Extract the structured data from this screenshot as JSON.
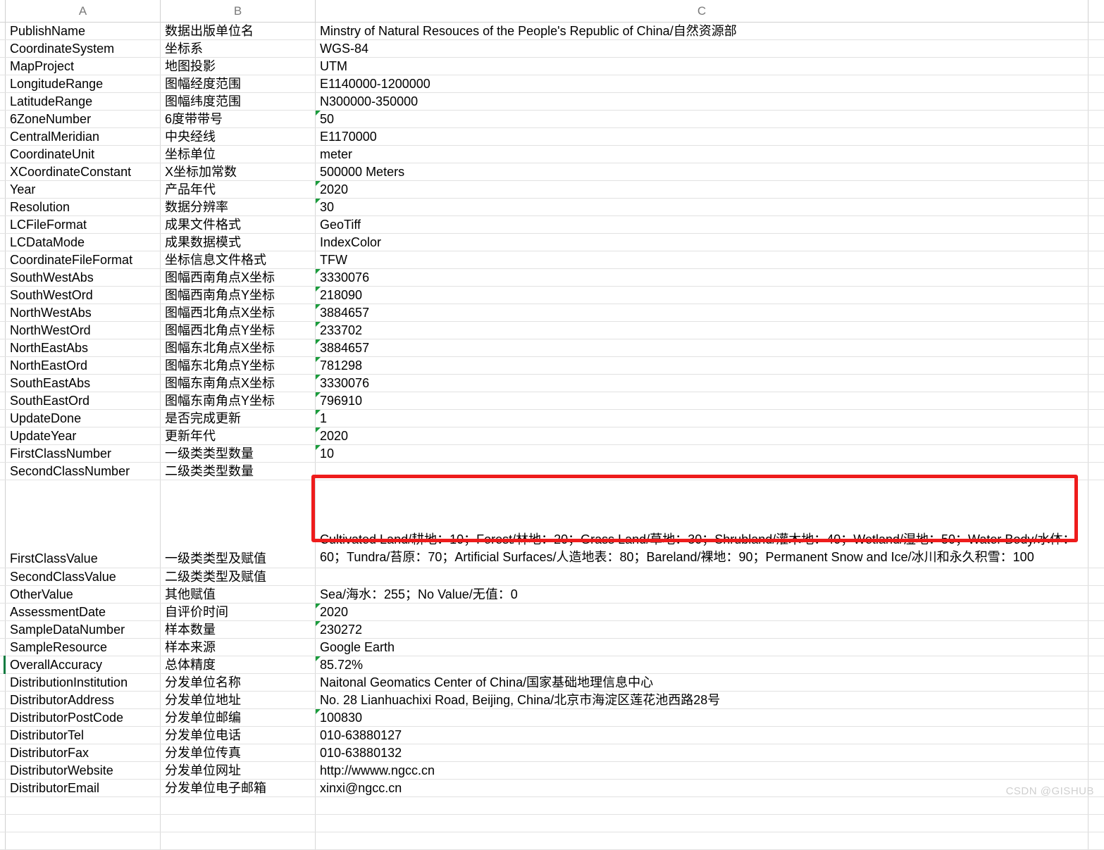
{
  "app": {
    "type": "spreadsheet",
    "watermark": "CSDN @GISHUB"
  },
  "columns": {
    "a": "A",
    "b": "B",
    "c": "C"
  },
  "colors": {
    "error_flag_green": "#1a9c3c",
    "selection_green": "#107c41",
    "annotation_red": "#ee1c1c",
    "grid_line": "#d8d8d8",
    "header_text": "#7a7a7a",
    "watermark": "#cfcfcf"
  },
  "rows": [
    {
      "a": "PublishName",
      "b": "数据出版单位名",
      "c": "Minstry of Natural Resouces of the People's Republic of China/自然资源部",
      "flag": false
    },
    {
      "a": "CoordinateSystem",
      "b": "坐标系",
      "c": "WGS-84",
      "flag": false
    },
    {
      "a": "MapProject",
      "b": "地图投影",
      "c": "UTM",
      "flag": false
    },
    {
      "a": "LongitudeRange",
      "b": "图幅经度范围",
      "c": "E1140000-1200000",
      "flag": false
    },
    {
      "a": "LatitudeRange",
      "b": "图幅纬度范围",
      "c": "N300000-350000",
      "flag": false
    },
    {
      "a": "6ZoneNumber",
      "b": "6度带带号",
      "c": "50",
      "flag": true
    },
    {
      "a": "CentralMeridian",
      "b": "中央经线",
      "c": "E1170000",
      "flag": false
    },
    {
      "a": "CoordinateUnit",
      "b": "坐标单位",
      "c": "meter",
      "flag": false
    },
    {
      "a": "XCoordinateConstant",
      "b": "X坐标加常数",
      "c": "500000 Meters",
      "flag": false
    },
    {
      "a": "Year",
      "b": "产品年代",
      "c": "2020",
      "flag": true
    },
    {
      "a": "Resolution",
      "b": "数据分辨率",
      "c": "30",
      "flag": true
    },
    {
      "a": "LCFileFormat",
      "b": "成果文件格式",
      "c": "GeoTiff",
      "flag": false
    },
    {
      "a": "LCDataMode",
      "b": "成果数据模式",
      "c": "IndexColor",
      "flag": false
    },
    {
      "a": "CoordinateFileFormat",
      "b": "坐标信息文件格式",
      "c": "TFW",
      "flag": false
    },
    {
      "a": "SouthWestAbs",
      "b": "图幅西南角点X坐标",
      "c": "3330076",
      "flag": true
    },
    {
      "a": "SouthWestOrd",
      "b": "图幅西南角点Y坐标",
      "c": "218090",
      "flag": true
    },
    {
      "a": "NorthWestAbs",
      "b": "图幅西北角点X坐标",
      "c": "3884657",
      "flag": true
    },
    {
      "a": "NorthWestOrd",
      "b": "图幅西北角点Y坐标",
      "c": "233702",
      "flag": true
    },
    {
      "a": "NorthEastAbs",
      "b": "图幅东北角点X坐标",
      "c": "3884657",
      "flag": true
    },
    {
      "a": "NorthEastOrd",
      "b": "图幅东北角点Y坐标",
      "c": "781298",
      "flag": true
    },
    {
      "a": "SouthEastAbs",
      "b": "图幅东南角点X坐标",
      "c": "3330076",
      "flag": true
    },
    {
      "a": "SouthEastOrd",
      "b": "图幅东南角点Y坐标",
      "c": "796910",
      "flag": true
    },
    {
      "a": "UpdateDone",
      "b": "是否完成更新",
      "c": "1",
      "flag": true
    },
    {
      "a": "UpdateYear",
      "b": "更新年代",
      "c": "2020",
      "flag": true
    },
    {
      "a": "FirstClassNumber",
      "b": "一级类类型数量",
      "c": "10",
      "flag": true
    },
    {
      "a": "SecondClassNumber",
      "b": "二级类类型数量",
      "c": "",
      "flag": false
    },
    {
      "a": "FirstClassValue",
      "b": "一级类类型及赋值",
      "c": "Cultivated Land/耕地：10；Forest/林地：20；Grass Land/草地：30；Shrubland/灌木地：40；Wetland/湿地：50；Water Body/水体：60；Tundra/苔原：70；Artificial Surfaces/人造地表：80；Bareland/裸地：90；Permanent Snow and Ice/冰川和永久积雪：100",
      "flag": false,
      "tall": true,
      "highlighted": true
    },
    {
      "a": "SecondClassValue",
      "b": "二级类类型及赋值",
      "c": "",
      "flag": false
    },
    {
      "a": "OtherValue",
      "b": "其他赋值",
      "c": "Sea/海水：255；No Value/无值：0",
      "flag": false
    },
    {
      "a": "AssessmentDate",
      "b": "自评价时间",
      "c": "2020",
      "flag": true
    },
    {
      "a": "SampleDataNumber",
      "b": "样本数量",
      "c": "230272",
      "flag": true
    },
    {
      "a": "SampleResource",
      "b": "样本来源",
      "c": "Google Earth",
      "flag": false
    },
    {
      "a": "OverallAccuracy",
      "b": "总体精度",
      "c": "85.72%",
      "flag": true,
      "selected": true
    },
    {
      "a": "DistributionInstitution",
      "b": "分发单位名称",
      "c": "Naitonal Geomatics Center of China/国家基础地理信息中心",
      "flag": false
    },
    {
      "a": "DistributorAddress",
      "b": "分发单位地址",
      "c": "No. 28 Lianhuachixi Road, Beijing, China/北京市海淀区莲花池西路28号",
      "flag": false
    },
    {
      "a": "DistributorPostCode",
      "b": "分发单位邮编",
      "c": "100830",
      "flag": true
    },
    {
      "a": "DistributorTel",
      "b": "分发单位电话",
      "c": "010-63880127",
      "flag": false
    },
    {
      "a": "DistributorFax",
      "b": "分发单位传真",
      "c": "010-63880132",
      "flag": false
    },
    {
      "a": "DistributorWebsite",
      "b": "分发单位网址",
      "c": "http://wwww.ngcc.cn",
      "flag": false
    },
    {
      "a": "DistributorEmail",
      "b": "分发单位电子邮箱",
      "c": "xinxi@ngcc.cn",
      "flag": false
    },
    {
      "a": "",
      "b": "",
      "c": "",
      "flag": false
    },
    {
      "a": "",
      "b": "",
      "c": "",
      "flag": false
    },
    {
      "a": "",
      "b": "",
      "c": "",
      "flag": false
    }
  ]
}
